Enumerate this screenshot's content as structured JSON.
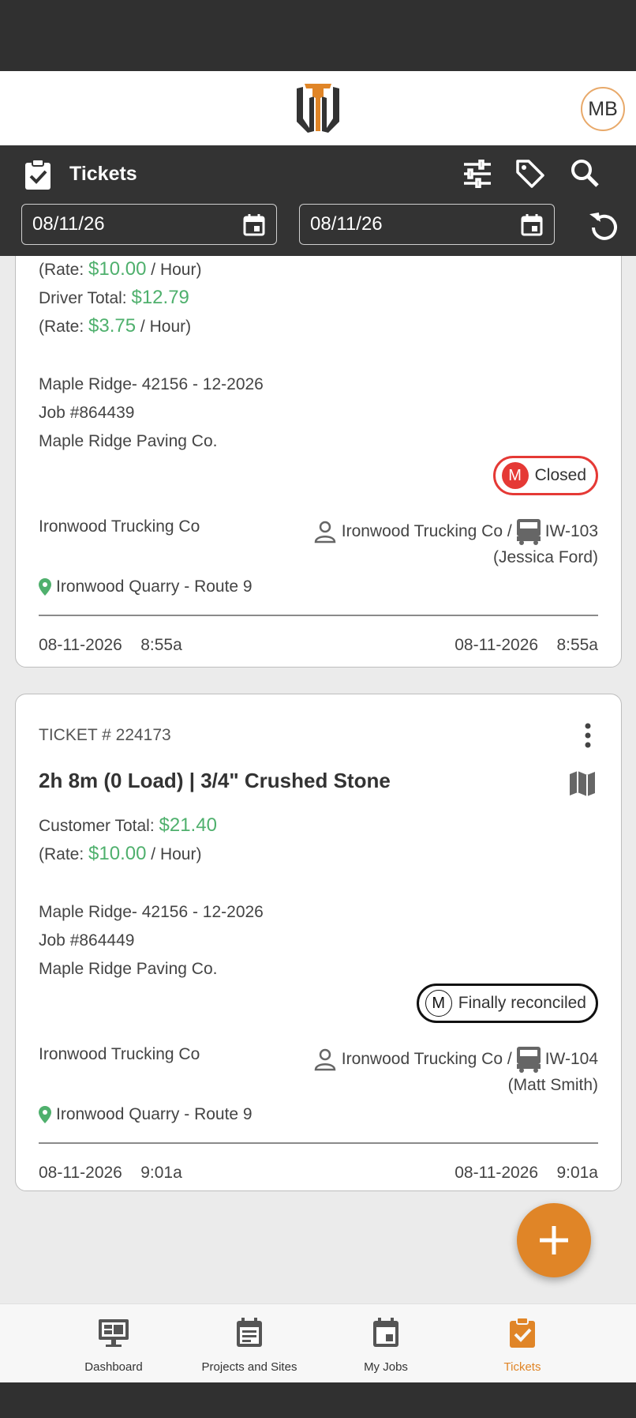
{
  "header": {
    "avatar_initials": "MB"
  },
  "toolbar": {
    "title": "Tickets",
    "start_date": "08/11/26",
    "end_date": "08/11/26"
  },
  "cards": [
    {
      "rate1_prefix": "(Rate: ",
      "rate1_value": "$10.00",
      "rate1_suffix": " / Hour)",
      "driver_label": "Driver Total: ",
      "driver_value": "$12.79",
      "rate2_prefix": "(Rate: ",
      "rate2_value": "$3.75",
      "rate2_suffix": " / Hour)",
      "project": "Maple Ridge- 42156 - 12-2026",
      "job": "Job #864439",
      "customer": "Maple Ridge Paving Co.",
      "status_letter": "M",
      "status": "Closed",
      "carrier": "Ironwood Trucking Co",
      "assignee": "Ironwood Trucking Co / ",
      "truck": "IW-103",
      "driver": "(Jessica Ford)",
      "location": "Ironwood Quarry - Route 9",
      "start_date": "08-11-2026",
      "start_time": "8:55a",
      "end_date": "08-11-2026",
      "end_time": "8:55a"
    },
    {
      "ticket_no": "TICKET # 224173",
      "title": "2h 8m (0 Load) | 3/4\" Crushed Stone",
      "customer_total_label": "Customer Total: ",
      "customer_total_value": "$21.40",
      "rate_prefix": "(Rate: ",
      "rate_value": "$10.00",
      "rate_suffix": " / Hour)",
      "project": "Maple Ridge- 42156 - 12-2026",
      "job": "Job #864449",
      "customer": "Maple Ridge Paving Co.",
      "status_letter": "M",
      "status": "Finally reconciled",
      "carrier": "Ironwood Trucking Co",
      "assignee": "Ironwood Trucking Co / ",
      "truck": "IW-104",
      "driver": "(Matt Smith)",
      "location": "Ironwood Quarry - Route 9",
      "start_date": "08-11-2026",
      "start_time": "9:01a",
      "end_date": "08-11-2026",
      "end_time": "9:01a"
    }
  ],
  "nav": [
    {
      "label": "Dashboard",
      "icon": "dashboard-icon"
    },
    {
      "label": "Projects and Sites",
      "icon": "calendar-list-icon"
    },
    {
      "label": "My Jobs",
      "icon": "calendar-icon"
    },
    {
      "label": "Tickets",
      "icon": "clipboard-check-icon"
    }
  ],
  "colors": {
    "accent": "#e08527",
    "money": "#4fb06d",
    "closed": "#e53935",
    "dark": "#333333"
  }
}
